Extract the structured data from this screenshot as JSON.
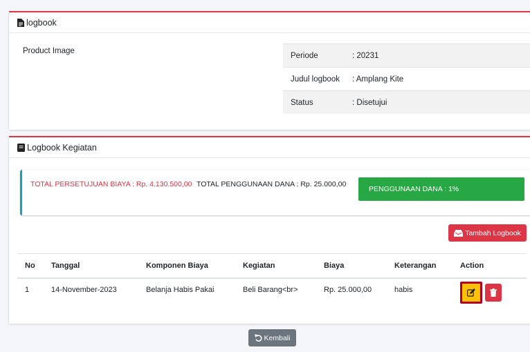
{
  "card1": {
    "title": "logbook",
    "product_image_label": "Product Image",
    "info": [
      {
        "label": "Periode",
        "value": ": 20231"
      },
      {
        "label": "Judul logbook",
        "value": ": Amplang Kite"
      },
      {
        "label": "Status",
        "value": ": Disetujui"
      }
    ]
  },
  "card2": {
    "title": "Logbook Kegiatan",
    "total_persetujuan": "TOTAL PERSETUJUAN BIAYA : Rp. 4.130.500,00",
    "total_penggunaan": "TOTAL PENGGUNAAN DANA : Rp. 25.000,00",
    "penggunaan_badge": "PENGGUNAAN DANA : 1%",
    "add_button": "Tambah Logbook",
    "table": {
      "headers": [
        "No",
        "Tanggal",
        "Komponen Biaya",
        "Kegiatan",
        "Biaya",
        "Keterangan",
        "Action"
      ],
      "rows": [
        [
          "1",
          "14-November-2023",
          "Belanja Habis Pakai",
          "Beli Barang<br>",
          "Rp. 25.000,00",
          "habis"
        ]
      ]
    }
  },
  "back_button": "Kembali",
  "colors": {
    "danger": "#dc3545",
    "success": "#28a745",
    "warning": "#ffc107",
    "info": "#17a2b8",
    "secondary": "#6c757d"
  }
}
